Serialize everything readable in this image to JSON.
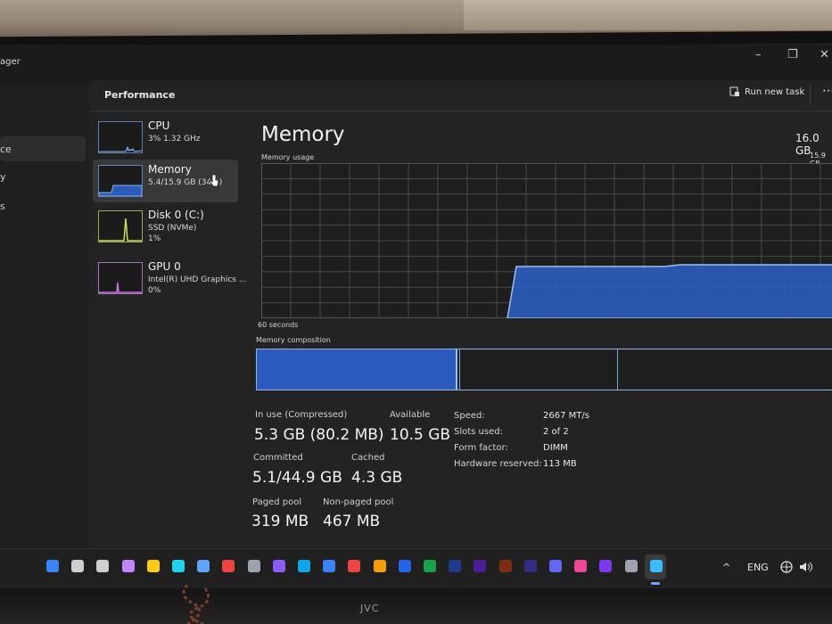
{
  "window": {
    "title": "ager",
    "controls": {
      "minimize": "–",
      "maximize": "❐",
      "close": "✕"
    }
  },
  "header": {
    "page_title": "Performance",
    "run_new_task": "Run new task",
    "more": "⋯"
  },
  "left_nav": {
    "items": [
      "ce",
      "y",
      "s"
    ]
  },
  "resources": [
    {
      "name": "CPU",
      "line1": "3%  1.32 GHz",
      "line2": ""
    },
    {
      "name": "Memory",
      "line1": "5.4/15.9 GB (34%)",
      "line2": ""
    },
    {
      "name": "Disk 0 (C:)",
      "line1": "SSD (NVMe)",
      "line2": "1%"
    },
    {
      "name": "GPU 0",
      "line1": "Intel(R) UHD Graphics ...",
      "line2": "0%"
    }
  ],
  "memory": {
    "title": "Memory",
    "total": "16.0 GB",
    "total_sub": "15.9 GB",
    "usage_label": "Memory usage",
    "time_label": "60 seconds",
    "composition_label": "Memory composition",
    "in_use_fraction": 0.34,
    "stats": {
      "in_use_label": "In use (Compressed)",
      "in_use_value": "5.3 GB (80.2 MB)",
      "available_label": "Available",
      "available_value": "10.5 GB",
      "committed_label": "Committed",
      "committed_value": "5.1/44.9 GB",
      "cached_label": "Cached",
      "cached_value": "4.3 GB",
      "paged_label": "Paged pool",
      "paged_value": "319 MB",
      "nonpaged_label": "Non-paged pool",
      "nonpaged_value": "467 MB"
    },
    "details": [
      {
        "key": "Speed:",
        "value": "2667 MT/s"
      },
      {
        "key": "Slots used:",
        "value": "2 of 2"
      },
      {
        "key": "Form factor:",
        "value": "DIMM"
      },
      {
        "key": "Hardware reserved:",
        "value": "113 MB"
      }
    ]
  },
  "taskbar": {
    "language": "ENG",
    "chevron": "^",
    "icons": [
      "windows-start",
      "search",
      "task-view",
      "copilot",
      "file-explorer",
      "edge",
      "store",
      "chrome",
      "obs",
      "teams",
      "skype",
      "messenger",
      "youtube",
      "photos",
      "outlook",
      "excel",
      "photoshop",
      "premiere",
      "illustrator",
      "after-effects",
      "teams-2",
      "instagram",
      "viber",
      "settings",
      "task-manager"
    ]
  },
  "monitor": {
    "brand": "JVC"
  },
  "colors": {
    "accent": "#2a5bbd",
    "graph_line": "#8fb3e3",
    "grid": "#4a4a4a"
  }
}
